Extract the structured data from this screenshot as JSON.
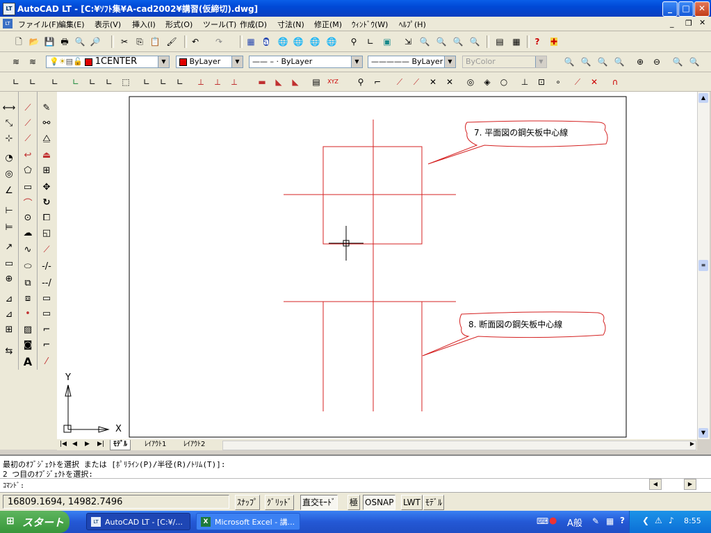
{
  "window": {
    "title": "AutoCAD LT - [C:¥ｿﾌﾄ集¥A-cad2002¥講習(仮締切).dwg]",
    "icon_label": "LT"
  },
  "menu": [
    "ファイル(F)",
    "編集(E)",
    "表示(V)",
    "挿入(I)",
    "形式(O)",
    "ツール(T)",
    "作成(D)",
    "寸法(N)",
    "修正(M)",
    "ｳｨﾝﾄﾞｳ(W)",
    "ﾍﾙﾌﾟ(H)"
  ],
  "layer": {
    "current": "1CENTER",
    "color": "ByLayer",
    "linetype": "ByLayer",
    "lineweight": "ByLayer",
    "plotstyle": "ByColor"
  },
  "callouts": {
    "plan": "7. 平面図の鋼矢板中心線",
    "section": "8. 断面図の鋼矢板中心線"
  },
  "ucs": {
    "x": "X",
    "y": "Y"
  },
  "tabs": [
    "ﾓﾃﾞﾙ",
    "ﾚｲｱｳﾄ1",
    "ﾚｲｱｳﾄ2"
  ],
  "command": {
    "line1": "最初のｵﾌﾞｼﾞｪｸﾄを選択 または [ﾎﾟﾘﾗｲﾝ(P)/半径(R)/ﾄﾘﾑ(T)]:",
    "line2": "2 つ目のｵﾌﾞｼﾞｪｸﾄを選択:",
    "prompt": "ｺﾏﾝﾄﾞ:"
  },
  "status": {
    "coords": "16809.1694, 14982.7496",
    "buttons": [
      "ｽﾅｯﾌﾟ",
      "ｸﾞﾘｯﾄﾞ",
      "直交ﾓｰﾄﾞ",
      "極",
      "OSNAP",
      "LWT",
      "ﾓﾃﾞﾙ"
    ]
  },
  "taskbar": {
    "start": "スタート",
    "items": [
      "AutoCAD LT - [C:¥/...",
      "Microsoft Excel - 講..."
    ],
    "ime": "A般",
    "clock": "8:55"
  },
  "colors": {
    "drawing_line": "#d42020",
    "titlebar": "#0a5ee8"
  }
}
